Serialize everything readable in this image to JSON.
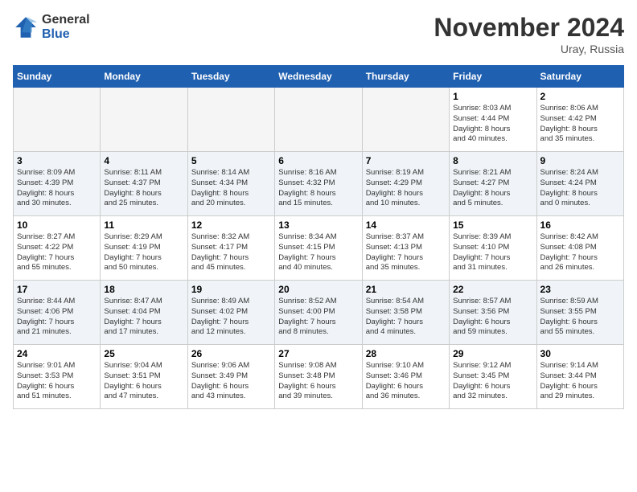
{
  "header": {
    "logo_line1": "General",
    "logo_line2": "Blue",
    "month": "November 2024",
    "location": "Uray, Russia"
  },
  "weekdays": [
    "Sunday",
    "Monday",
    "Tuesday",
    "Wednesday",
    "Thursday",
    "Friday",
    "Saturday"
  ],
  "weeks": [
    [
      {
        "day": "",
        "info": ""
      },
      {
        "day": "",
        "info": ""
      },
      {
        "day": "",
        "info": ""
      },
      {
        "day": "",
        "info": ""
      },
      {
        "day": "",
        "info": ""
      },
      {
        "day": "1",
        "info": "Sunrise: 8:03 AM\nSunset: 4:44 PM\nDaylight: 8 hours\nand 40 minutes."
      },
      {
        "day": "2",
        "info": "Sunrise: 8:06 AM\nSunset: 4:42 PM\nDaylight: 8 hours\nand 35 minutes."
      }
    ],
    [
      {
        "day": "3",
        "info": "Sunrise: 8:09 AM\nSunset: 4:39 PM\nDaylight: 8 hours\nand 30 minutes."
      },
      {
        "day": "4",
        "info": "Sunrise: 8:11 AM\nSunset: 4:37 PM\nDaylight: 8 hours\nand 25 minutes."
      },
      {
        "day": "5",
        "info": "Sunrise: 8:14 AM\nSunset: 4:34 PM\nDaylight: 8 hours\nand 20 minutes."
      },
      {
        "day": "6",
        "info": "Sunrise: 8:16 AM\nSunset: 4:32 PM\nDaylight: 8 hours\nand 15 minutes."
      },
      {
        "day": "7",
        "info": "Sunrise: 8:19 AM\nSunset: 4:29 PM\nDaylight: 8 hours\nand 10 minutes."
      },
      {
        "day": "8",
        "info": "Sunrise: 8:21 AM\nSunset: 4:27 PM\nDaylight: 8 hours\nand 5 minutes."
      },
      {
        "day": "9",
        "info": "Sunrise: 8:24 AM\nSunset: 4:24 PM\nDaylight: 8 hours\nand 0 minutes."
      }
    ],
    [
      {
        "day": "10",
        "info": "Sunrise: 8:27 AM\nSunset: 4:22 PM\nDaylight: 7 hours\nand 55 minutes."
      },
      {
        "day": "11",
        "info": "Sunrise: 8:29 AM\nSunset: 4:19 PM\nDaylight: 7 hours\nand 50 minutes."
      },
      {
        "day": "12",
        "info": "Sunrise: 8:32 AM\nSunset: 4:17 PM\nDaylight: 7 hours\nand 45 minutes."
      },
      {
        "day": "13",
        "info": "Sunrise: 8:34 AM\nSunset: 4:15 PM\nDaylight: 7 hours\nand 40 minutes."
      },
      {
        "day": "14",
        "info": "Sunrise: 8:37 AM\nSunset: 4:13 PM\nDaylight: 7 hours\nand 35 minutes."
      },
      {
        "day": "15",
        "info": "Sunrise: 8:39 AM\nSunset: 4:10 PM\nDaylight: 7 hours\nand 31 minutes."
      },
      {
        "day": "16",
        "info": "Sunrise: 8:42 AM\nSunset: 4:08 PM\nDaylight: 7 hours\nand 26 minutes."
      }
    ],
    [
      {
        "day": "17",
        "info": "Sunrise: 8:44 AM\nSunset: 4:06 PM\nDaylight: 7 hours\nand 21 minutes."
      },
      {
        "day": "18",
        "info": "Sunrise: 8:47 AM\nSunset: 4:04 PM\nDaylight: 7 hours\nand 17 minutes."
      },
      {
        "day": "19",
        "info": "Sunrise: 8:49 AM\nSunset: 4:02 PM\nDaylight: 7 hours\nand 12 minutes."
      },
      {
        "day": "20",
        "info": "Sunrise: 8:52 AM\nSunset: 4:00 PM\nDaylight: 7 hours\nand 8 minutes."
      },
      {
        "day": "21",
        "info": "Sunrise: 8:54 AM\nSunset: 3:58 PM\nDaylight: 7 hours\nand 4 minutes."
      },
      {
        "day": "22",
        "info": "Sunrise: 8:57 AM\nSunset: 3:56 PM\nDaylight: 6 hours\nand 59 minutes."
      },
      {
        "day": "23",
        "info": "Sunrise: 8:59 AM\nSunset: 3:55 PM\nDaylight: 6 hours\nand 55 minutes."
      }
    ],
    [
      {
        "day": "24",
        "info": "Sunrise: 9:01 AM\nSunset: 3:53 PM\nDaylight: 6 hours\nand 51 minutes."
      },
      {
        "day": "25",
        "info": "Sunrise: 9:04 AM\nSunset: 3:51 PM\nDaylight: 6 hours\nand 47 minutes."
      },
      {
        "day": "26",
        "info": "Sunrise: 9:06 AM\nSunset: 3:49 PM\nDaylight: 6 hours\nand 43 minutes."
      },
      {
        "day": "27",
        "info": "Sunrise: 9:08 AM\nSunset: 3:48 PM\nDaylight: 6 hours\nand 39 minutes."
      },
      {
        "day": "28",
        "info": "Sunrise: 9:10 AM\nSunset: 3:46 PM\nDaylight: 6 hours\nand 36 minutes."
      },
      {
        "day": "29",
        "info": "Sunrise: 9:12 AM\nSunset: 3:45 PM\nDaylight: 6 hours\nand 32 minutes."
      },
      {
        "day": "30",
        "info": "Sunrise: 9:14 AM\nSunset: 3:44 PM\nDaylight: 6 hours\nand 29 minutes."
      }
    ]
  ]
}
